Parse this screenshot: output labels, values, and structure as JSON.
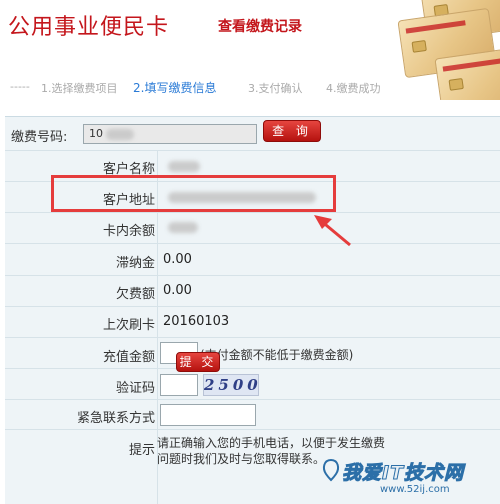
{
  "header": {
    "title": "公用事业便民卡",
    "view_records_link": "查看缴费记录"
  },
  "steps": {
    "prefix": "-----",
    "step1": "1.选择缴费项目",
    "step2": "2.填写缴费信息",
    "step3": "3.支付确认",
    "step4": "4.缴费成功"
  },
  "form": {
    "account_label": "缴费号码:",
    "account_value": "10",
    "query_button": "查 询",
    "customer_name_label": "客户名称",
    "customer_address_label": "客户地址",
    "card_balance_label": "卡内余额",
    "late_fee_label": "滞纳金",
    "late_fee_value": "0.00",
    "arrears_label": "欠费额",
    "arrears_value": "0.00",
    "last_swipe_label": "上次刷卡",
    "last_swipe_value": "20160103",
    "recharge_label": "充值金额",
    "recharge_note": "(支付金额不能低于缴费金额)",
    "captcha_label": "验证码",
    "captcha_image_text": "2500",
    "emergency_contact_label": "紧急联系方式",
    "tip_label": "提示",
    "tip_line1": "请正确输入您的手机电话，以便于发生缴费",
    "tip_line2": "问题时我们及时与您取得联系。",
    "submit_button": "提 交"
  },
  "watermark": {
    "text": "我爱IT技术网",
    "url": "www.52ij.com"
  },
  "colors": {
    "brand_red": "#c4161c",
    "step_active": "#2b7bd6",
    "form_background": "#eef4f7",
    "highlight_red": "#e53c3c"
  }
}
